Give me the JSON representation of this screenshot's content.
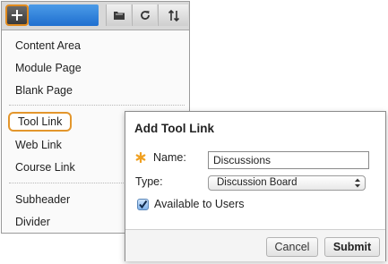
{
  "toolbar": {
    "accent": "#e08a1e",
    "icons": [
      "add-icon",
      "folder-icon",
      "refresh-icon",
      "sort-icon"
    ]
  },
  "menu": {
    "items": [
      {
        "label": "Content Area"
      },
      {
        "label": "Module Page"
      },
      {
        "label": "Blank Page"
      },
      {
        "label": "Tool Link",
        "selected": true
      },
      {
        "label": "Web Link"
      },
      {
        "label": "Course Link"
      },
      {
        "label": "Subheader"
      },
      {
        "label": "Divider"
      }
    ]
  },
  "dialog": {
    "title": "Add Tool Link",
    "name_label": "Name:",
    "name_value": "Discussions",
    "type_label": "Type:",
    "type_value": "Discussion Board",
    "available_label": "Available to Users",
    "available_checked": true,
    "cancel_label": "Cancel",
    "submit_label": "Submit"
  },
  "colors": {
    "required_star": "#f0a020",
    "selected_outline": "#e3962c"
  }
}
